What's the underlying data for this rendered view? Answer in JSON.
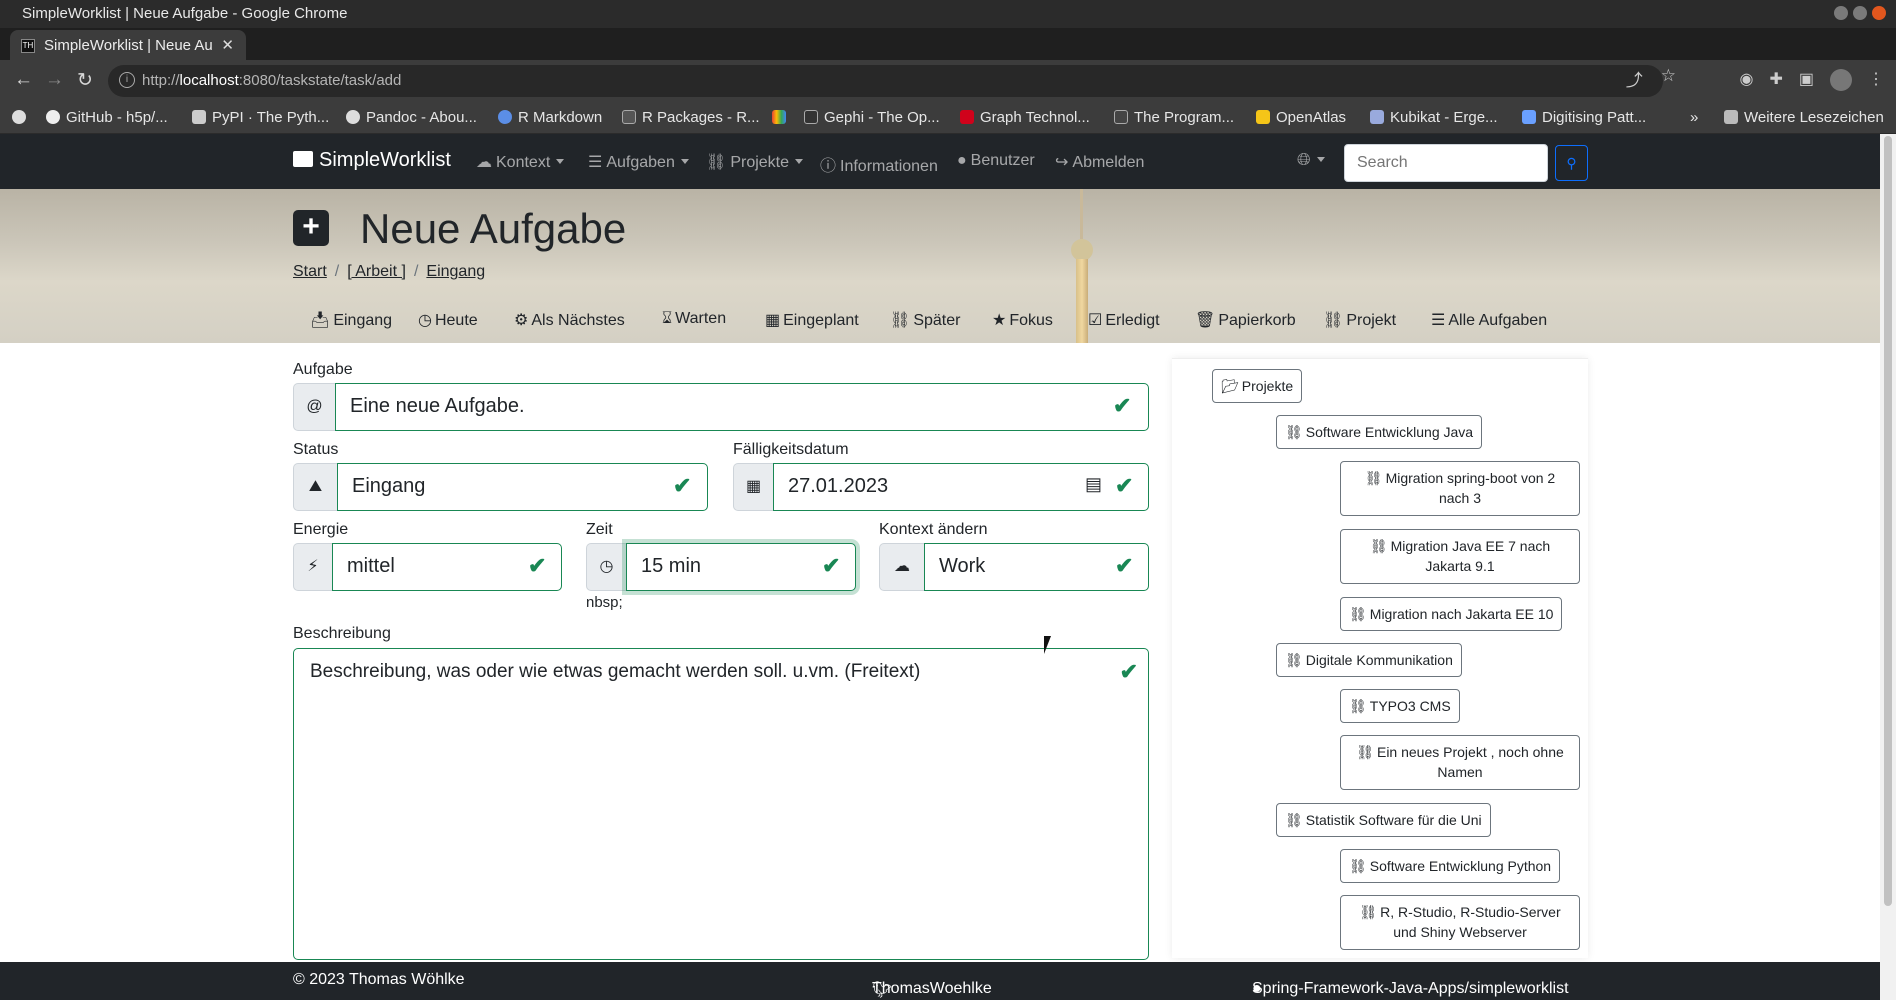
{
  "browser": {
    "window_title": "SimpleWorklist | Neue Aufgabe - Google Chrome",
    "tab_title": "SimpleWorklist | Neue Au",
    "tab_favicon": "TH",
    "url_prefix": "http://",
    "url_host": "localhost",
    "url_rest": ":8080/taskstate/task/add",
    "bookmarks": [
      "GitHub - h5p/...",
      "PyPI · The Pyth...",
      "Pandoc - Abou...",
      "R Markdown",
      "R Packages - R...",
      "",
      "Gephi - The Op...",
      "Graph Technol...",
      "The Program...",
      "OpenAtlas",
      "Kubikat - Erge...",
      "Digitising Patt..."
    ],
    "bookmarks_more": "»",
    "other_bookmarks": "Weitere Lesezeichen"
  },
  "navbar": {
    "brand": "SimpleWorklist",
    "items": [
      {
        "label": "Kontext",
        "icon": "cloud-icon"
      },
      {
        "label": "Aufgaben",
        "icon": "database-icon"
      },
      {
        "label": "Projekte",
        "icon": "diagram-icon"
      },
      {
        "label": "Informationen",
        "icon": "info-circle-icon"
      },
      {
        "label": "Benutzer",
        "icon": "person-icon"
      },
      {
        "label": "Abmelden",
        "icon": "logout-icon"
      }
    ],
    "search_placeholder": "Search"
  },
  "header": {
    "title": "Neue Aufgabe",
    "breadcrumb": [
      "Start",
      "[ Arbeit ]",
      "Eingang"
    ]
  },
  "subnav": [
    {
      "label": "Eingang",
      "icon": "inbox-icon"
    },
    {
      "label": "Heute",
      "icon": "clock-icon"
    },
    {
      "label": "Als Nächstes",
      "icon": "gears-icon"
    },
    {
      "label": "Warten",
      "icon": "hourglass-icon"
    },
    {
      "label": "Eingeplant",
      "icon": "calendar-icon"
    },
    {
      "label": "Später",
      "icon": "binoculars-icon"
    },
    {
      "label": "Fokus",
      "icon": "star-icon"
    },
    {
      "label": "Erledigt",
      "icon": "check-square-icon"
    },
    {
      "label": "Papierkorb",
      "icon": "trash-icon"
    },
    {
      "label": "Projekt",
      "icon": "diagram-icon"
    },
    {
      "label": "Alle Aufgaben",
      "icon": "database-icon"
    }
  ],
  "form": {
    "aufgabe": {
      "label": "Aufgabe",
      "addon": "@",
      "value": "Eine neue Aufgabe."
    },
    "status": {
      "label": "Status",
      "value": "Eingang"
    },
    "faelligkeit": {
      "label": "Fälligkeitsdatum",
      "value": "27.01.2023"
    },
    "energie": {
      "label": "Energie",
      "value": "mittel"
    },
    "zeit": {
      "label": "Zeit",
      "value": "15 min",
      "note": "nbsp;"
    },
    "kontext": {
      "label": "Kontext ändern",
      "value": "Work"
    },
    "beschreibung": {
      "label": "Beschreibung",
      "value": "Beschreibung, was oder wie etwas gemacht werden soll. u.vm. (Freitext)"
    }
  },
  "project_tree": {
    "root": "Projekte",
    "nodes": [
      "Software Entwicklung Java",
      "Migration spring-boot von 2 nach 3",
      "Migration Java EE 7 nach Jakarta 9.1",
      "Migration nach Jakarta EE 10",
      "Digitale Kommunikation",
      "TYPO3 CMS",
      "Ein neues Projekt , noch ohne Namen",
      "Statistik Software für die Uni",
      "Software Entwicklung Python",
      "R, R-Studio, R-Studio-Server und Shiny Webserver"
    ]
  },
  "footer": {
    "copyright": "© 2023 Thomas Wöhlke",
    "twitter": "ThomasWoehlke",
    "github": "Spring-Framework-Java-Apps/simpleworklist"
  },
  "colors": {
    "valid_green": "#198754",
    "navbar_dark": "#212529",
    "primary_blue": "#0d6efd"
  }
}
